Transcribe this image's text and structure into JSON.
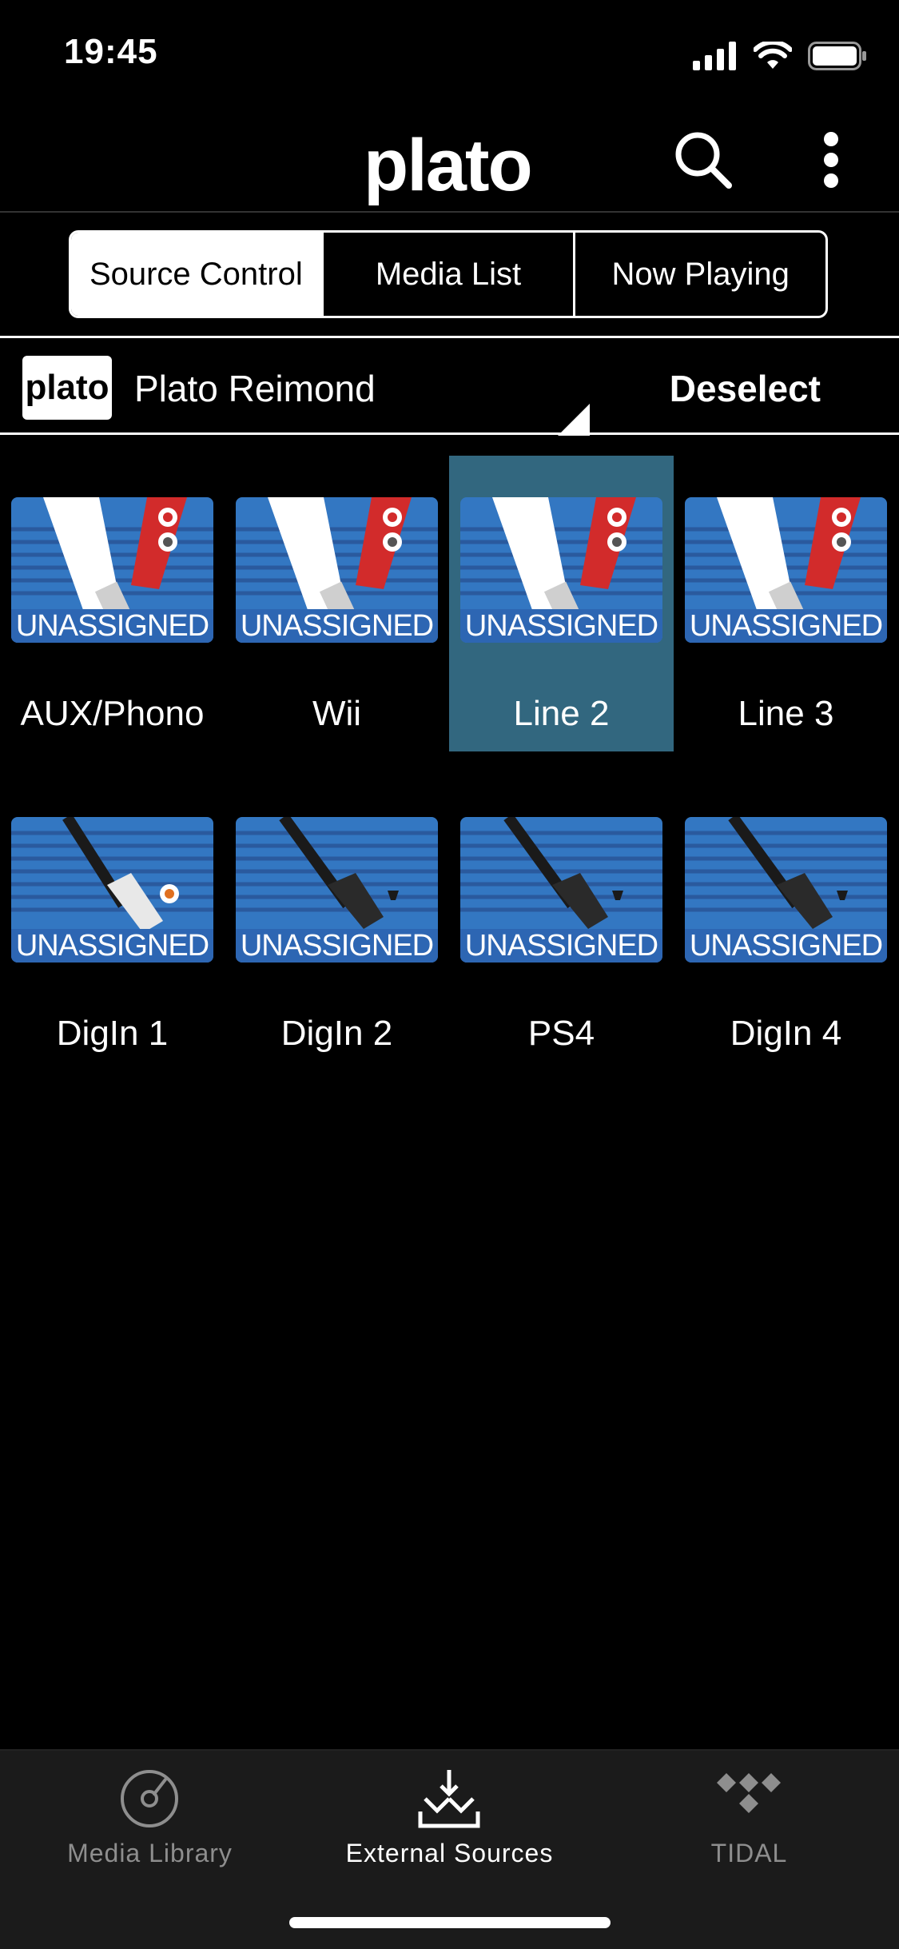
{
  "status": {
    "time": "19:45"
  },
  "header": {
    "logo": "plato"
  },
  "segments": [
    {
      "label": "Source Control",
      "active": true
    },
    {
      "label": "Media List",
      "active": false
    },
    {
      "label": "Now Playing",
      "active": false
    }
  ],
  "device": {
    "logo": "plato",
    "name": "Plato Reimond",
    "deselect_label": "Deselect"
  },
  "sources": [
    {
      "label": "AUX/Phono",
      "badge": "UNASSIGNED",
      "icon": "rca-cable-icon",
      "selected": false
    },
    {
      "label": "Wii",
      "badge": "UNASSIGNED",
      "icon": "rca-cable-icon",
      "selected": false
    },
    {
      "label": "Line 2",
      "badge": "UNASSIGNED",
      "icon": "rca-cable-icon",
      "selected": true
    },
    {
      "label": "Line 3",
      "badge": "UNASSIGNED",
      "icon": "rca-cable-icon",
      "selected": false
    },
    {
      "label": "DigIn 1",
      "badge": "UNASSIGNED",
      "icon": "coaxial-cable-icon",
      "selected": false
    },
    {
      "label": "DigIn 2",
      "badge": "UNASSIGNED",
      "icon": "optical-cable-icon",
      "selected": false
    },
    {
      "label": "PS4",
      "badge": "UNASSIGNED",
      "icon": "optical-cable-icon",
      "selected": false
    },
    {
      "label": "DigIn 4",
      "badge": "UNASSIGNED",
      "icon": "optical-cable-icon",
      "selected": false
    }
  ],
  "tabs": [
    {
      "label": "Media Library",
      "icon": "vinyl-disc-icon",
      "active": false
    },
    {
      "label": "External Sources",
      "icon": "input-arrows-icon",
      "active": true
    },
    {
      "label": "TIDAL",
      "icon": "tidal-logo-icon",
      "active": false
    }
  ],
  "colors": {
    "background": "#000000",
    "tile_blue": "#3377c2",
    "selected_tile": "#32677f",
    "tab_bar": "#1b1b1b"
  }
}
